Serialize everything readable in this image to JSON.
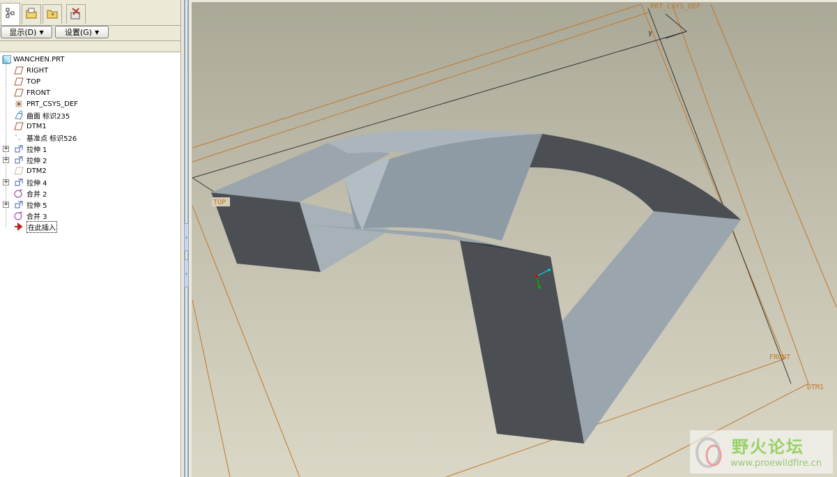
{
  "navigator": {
    "tabs": [
      {
        "name": "model-tree-tab",
        "icon": "model-tree-icon"
      },
      {
        "name": "folder-browser-tab",
        "icon": "folder-icon"
      },
      {
        "name": "favorites-tab",
        "icon": "favorites-icon"
      },
      {
        "name": "connections-tab",
        "icon": "tools-icon"
      }
    ],
    "show_menu_label": "显示(D)",
    "settings_menu_label": "设置(G)"
  },
  "model_tree": {
    "root": "WANCHEN.PRT",
    "items": [
      {
        "label": "RIGHT",
        "icon": "datum-plane-icon",
        "expandable": false
      },
      {
        "label": "TOP",
        "icon": "datum-plane-icon",
        "expandable": false
      },
      {
        "label": "FRONT",
        "icon": "datum-plane-icon",
        "expandable": false
      },
      {
        "label": "PRT_CSYS_DEF",
        "icon": "csys-icon",
        "expandable": false
      },
      {
        "label": "曲面 标识235",
        "icon": "surface-icon",
        "expandable": false
      },
      {
        "label": "DTM1",
        "icon": "datum-plane-icon",
        "expandable": false
      },
      {
        "label": "基准点 标识526",
        "icon": "datum-point-icon",
        "expandable": false
      },
      {
        "label": "拉伸 1",
        "icon": "extrude-icon",
        "expandable": true
      },
      {
        "label": "拉伸 2",
        "icon": "extrude-icon",
        "expandable": true
      },
      {
        "label": "DTM2",
        "icon": "datum-plane-hidden-icon",
        "expandable": false
      },
      {
        "label": "拉伸 4",
        "icon": "extrude-icon",
        "expandable": true
      },
      {
        "label": "合并 2",
        "icon": "merge-icon",
        "expandable": false
      },
      {
        "label": "拉伸 5",
        "icon": "extrude-icon",
        "expandable": true
      },
      {
        "label": "合并 3",
        "icon": "merge-icon",
        "expandable": false
      },
      {
        "label": "在此插入",
        "icon": "insert-here-arrow-icon",
        "expandable": false
      }
    ]
  },
  "graphics": {
    "datum_labels": {
      "csys": "PRT_CSYS_DEF",
      "top": "TOP",
      "front": "FRONT",
      "dtm1": "DTM1",
      "y_axis": "y"
    },
    "colors": {
      "datum_plane": "#c0782a",
      "part_light": "#9aa5ad",
      "part_dark": "#4b4f54",
      "background": "#c2bfae"
    }
  },
  "watermark": {
    "chinese": "野火论坛",
    "url": "www.proewildfire.cn"
  }
}
